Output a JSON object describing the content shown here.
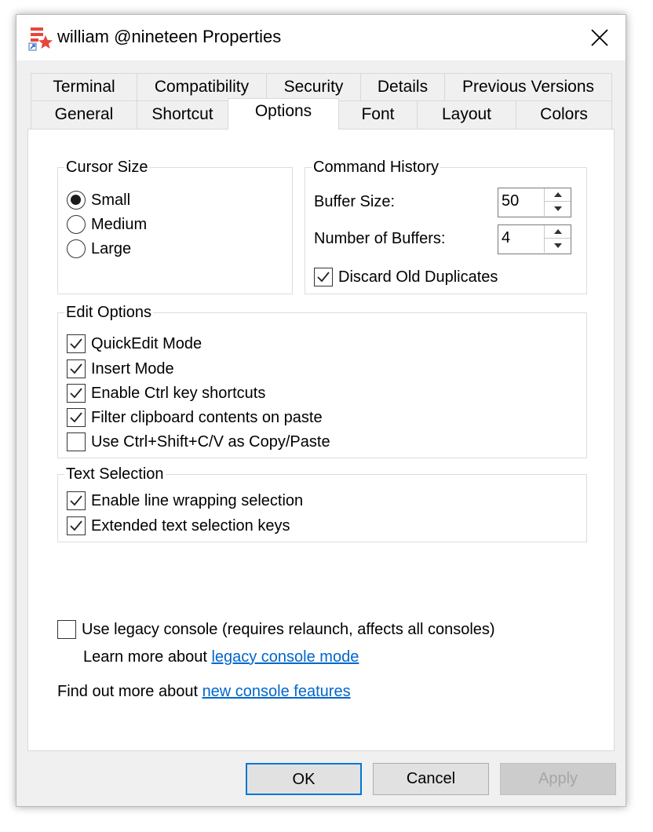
{
  "window": {
    "title": "william @nineteen Properties"
  },
  "tabs": {
    "back": [
      "Terminal",
      "Compatibility",
      "Security",
      "Details",
      "Previous Versions"
    ],
    "front": [
      "General",
      "Shortcut",
      "Options",
      "Font",
      "Layout",
      "Colors"
    ],
    "active": "Options"
  },
  "cursor_size": {
    "legend": "Cursor Size",
    "options": [
      {
        "label": "Small",
        "selected": true
      },
      {
        "label": "Medium",
        "selected": false
      },
      {
        "label": "Large",
        "selected": false
      }
    ]
  },
  "command_history": {
    "legend": "Command History",
    "buffer_size_label": "Buffer Size:",
    "buffer_size_value": "50",
    "num_buffers_label": "Number of Buffers:",
    "num_buffers_value": "4",
    "discard_label": "Discard Old Duplicates",
    "discard_checked": true
  },
  "edit_options": {
    "legend": "Edit Options",
    "items": [
      {
        "label": "QuickEdit Mode",
        "checked": true
      },
      {
        "label": "Insert Mode",
        "checked": true
      },
      {
        "label": "Enable Ctrl key shortcuts",
        "checked": true
      },
      {
        "label": "Filter clipboard contents on paste",
        "checked": true
      },
      {
        "label": "Use Ctrl+Shift+C/V as Copy/Paste",
        "checked": false
      }
    ]
  },
  "text_selection": {
    "legend": "Text Selection",
    "items": [
      {
        "label": "Enable line wrapping selection",
        "checked": true
      },
      {
        "label": "Extended text selection keys",
        "checked": true
      }
    ]
  },
  "legacy": {
    "label": "Use legacy console (requires relaunch, affects all consoles)",
    "checked": false,
    "learn_prefix": "Learn more about ",
    "learn_link": "legacy console mode"
  },
  "find_more": {
    "prefix": "Find out more about ",
    "link": "new console features"
  },
  "buttons": {
    "ok": "OK",
    "cancel": "Cancel",
    "apply": "Apply"
  }
}
